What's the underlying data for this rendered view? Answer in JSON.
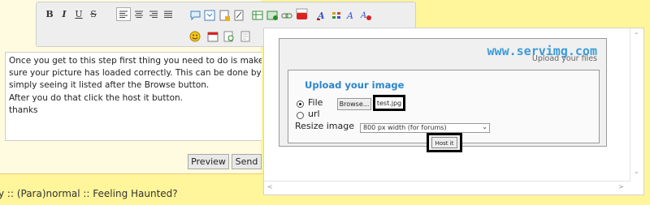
{
  "editor": {
    "toolbar": {
      "bold": "B",
      "italic": "I",
      "underline": "U",
      "strike": "S"
    },
    "text_lines": [
      "Once you get to this step first thing you need to do is make",
      "sure your picture has loaded correctly. This can be done by",
      "simply seeing it listed after the Browse button.",
      "After you do that click the host it button.",
      "thanks"
    ],
    "preview_label": "Preview",
    "send_label": "Send"
  },
  "breadcrumb": "y :: (Para)normal :: Feeling Haunted?",
  "popup": {
    "logo_main": "www.servimg.com",
    "logo_sub": "Upload your files",
    "title": "Upload your image",
    "file_label": "File",
    "browse_label": "Browse...",
    "filename": "test.jpg",
    "url_label": "url",
    "resize_label": "Resize image",
    "resize_value": "800 px width (for forums)",
    "host_label": "Host it"
  },
  "colors": {
    "page_bg": "#fff59a",
    "title_blue": "#2a86cc",
    "logo_blue": "#3b9bd9"
  }
}
